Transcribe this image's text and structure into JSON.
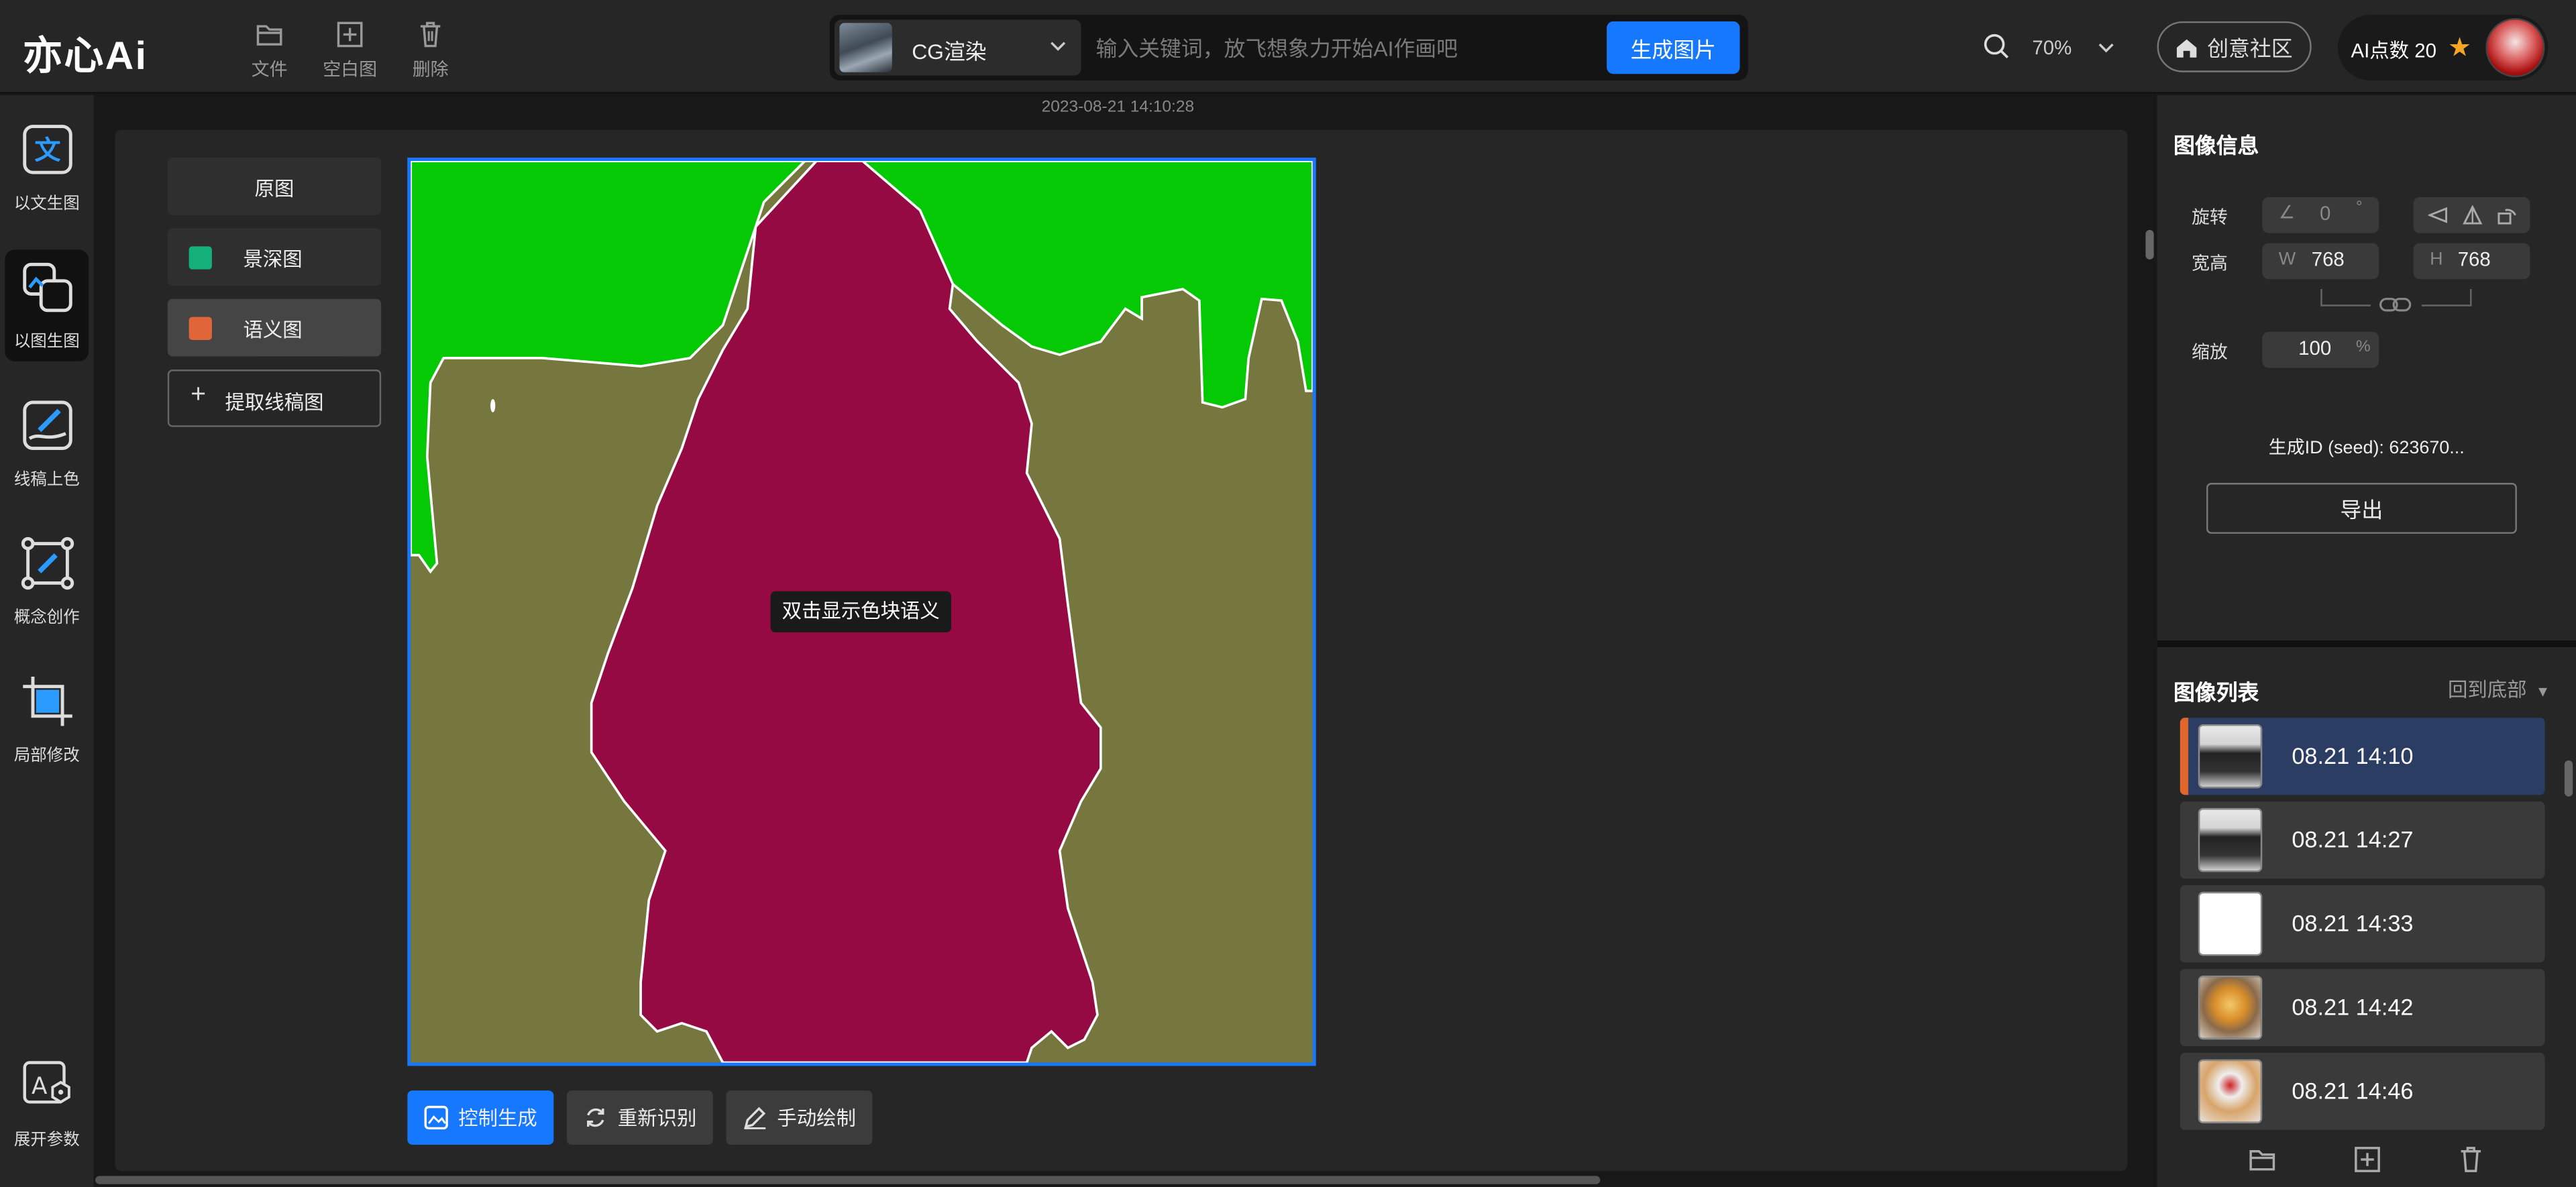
{
  "app": {
    "logo": "亦心Ai"
  },
  "toolbar": {
    "file": "文件",
    "blank": "空白图",
    "delete": "删除"
  },
  "model": {
    "name": "CG渲染",
    "placeholder": "输入关键词，放飞想象力开始AI作画吧",
    "generate": "生成图片"
  },
  "zoom": "70%",
  "community": "创意社区",
  "points": "AI点数 20",
  "sidebar": [
    {
      "label": "以文生图",
      "icon": "text-to-image-icon"
    },
    {
      "label": "以图生图",
      "icon": "image-to-image-icon",
      "active": true
    },
    {
      "label": "线稿上色",
      "icon": "line-coloring-icon"
    },
    {
      "label": "概念创作",
      "icon": "concept-icon"
    },
    {
      "label": "局部修改",
      "icon": "crop-edit-icon"
    },
    {
      "label": "展开参数",
      "icon": "params-icon"
    }
  ],
  "canvas": {
    "timestamp": "2023-08-21 14:10:28",
    "views": [
      {
        "label": "原图"
      },
      {
        "label": "景深图",
        "color": "#13b07a"
      },
      {
        "label": "语义图",
        "color": "#e0663a"
      }
    ],
    "extract": "提取线稿图",
    "tooltip": "双击显示色块语义",
    "segment_colors": {
      "sky": "#05c905",
      "ground": "#76763f",
      "person": "#950a42"
    },
    "actions": {
      "control": "控制生成",
      "redetect": "重新识别",
      "manual": "手动绘制"
    }
  },
  "info": {
    "title": "图像信息",
    "rotate_label": "旋转",
    "rotate_value": "0",
    "rotate_unit": "°",
    "size_label": "宽高",
    "w_prefix": "W",
    "width": "768",
    "h_prefix": "H",
    "height": "768",
    "scale_label": "缩放",
    "scale_value": "100",
    "scale_unit": "%",
    "seed": "生成ID (seed): 623670...",
    "export": "导出"
  },
  "list": {
    "title": "图像列表",
    "to_bottom": "回到底部",
    "items": [
      {
        "time": "08.21 14:10",
        "selected": true
      },
      {
        "time": "08.21 14:27"
      },
      {
        "time": "08.21 14:33"
      },
      {
        "time": "08.21 14:42"
      },
      {
        "time": "08.21 14:46"
      }
    ]
  },
  "colors": {
    "accent": "#1677ff",
    "selected_row": "#2c3d64",
    "marker": "#e0662b"
  }
}
